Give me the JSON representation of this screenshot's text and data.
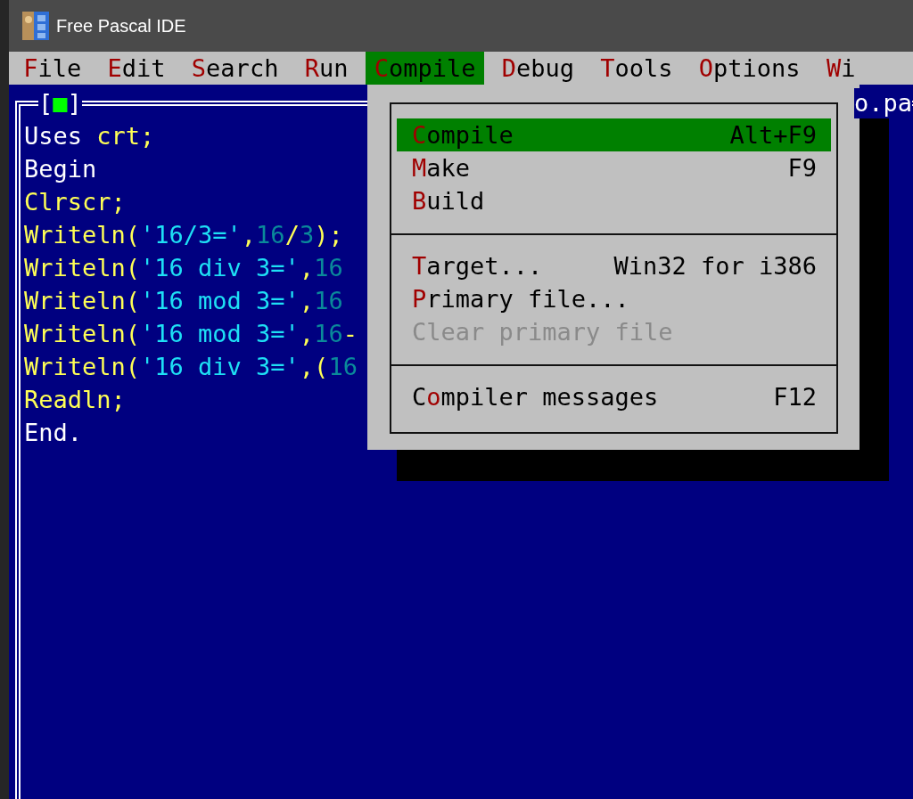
{
  "window": {
    "title": "Free Pascal IDE"
  },
  "menu_bar": [
    {
      "label": {
        "key": "F",
        "post": "ile"
      },
      "selected": false
    },
    {
      "label": {
        "key": "E",
        "post": "dit"
      },
      "selected": false
    },
    {
      "label": {
        "key": "S",
        "post": "earch"
      },
      "selected": false
    },
    {
      "label": {
        "key": "R",
        "post": "un"
      },
      "selected": false
    },
    {
      "label": {
        "key": "C",
        "post": "ompile"
      },
      "selected": true
    },
    {
      "label": {
        "key": "D",
        "post": "ebug"
      },
      "selected": false
    },
    {
      "label": {
        "key": "T",
        "post": "ools"
      },
      "selected": false
    },
    {
      "label": {
        "key": "O",
        "post": "ptions"
      },
      "selected": false
    },
    {
      "label": {
        "key": "W",
        "post": "i"
      },
      "selected": false
    }
  ],
  "editor": {
    "close_button": {
      "open": "[",
      "mark": "■",
      "close": "]"
    },
    "title": "o.pa",
    "lines": [
      [
        {
          "kind": "keyword",
          "text": "Uses"
        },
        {
          "kind": "ident",
          "text": " crt;"
        }
      ],
      [
        {
          "kind": "keyword",
          "text": "Begin"
        }
      ],
      [
        {
          "kind": "ident",
          "text": "Clrscr;"
        }
      ],
      [
        {
          "kind": "ident",
          "text": "Writeln("
        },
        {
          "kind": "string",
          "text": "'16/3='"
        },
        {
          "kind": "ident",
          "text": ","
        },
        {
          "kind": "number",
          "text": "16"
        },
        {
          "kind": "ident",
          "text": "/"
        },
        {
          "kind": "number",
          "text": "3"
        },
        {
          "kind": "ident",
          "text": ");"
        }
      ],
      [
        {
          "kind": "ident",
          "text": "Writeln("
        },
        {
          "kind": "string",
          "text": "'16 div 3='"
        },
        {
          "kind": "ident",
          "text": ","
        },
        {
          "kind": "number",
          "text": "16"
        }
      ],
      [
        {
          "kind": "ident",
          "text": "Writeln("
        },
        {
          "kind": "string",
          "text": "'16 mod 3='"
        },
        {
          "kind": "ident",
          "text": ","
        },
        {
          "kind": "number",
          "text": "16"
        }
      ],
      [
        {
          "kind": "ident",
          "text": "Writeln("
        },
        {
          "kind": "string",
          "text": "'16 mod 3='"
        },
        {
          "kind": "ident",
          "text": ","
        },
        {
          "kind": "number",
          "text": "16"
        },
        {
          "kind": "ident",
          "text": "-"
        }
      ],
      [
        {
          "kind": "ident",
          "text": "Writeln("
        },
        {
          "kind": "string",
          "text": "'16 div 3='"
        },
        {
          "kind": "ident",
          "text": ",("
        },
        {
          "kind": "number",
          "text": "16"
        }
      ],
      [
        {
          "kind": "ident",
          "text": "Readln;"
        }
      ],
      [
        {
          "kind": "keyword",
          "text": "End."
        }
      ]
    ]
  },
  "compile_menu": {
    "sections": [
      [
        {
          "label": {
            "key": "C",
            "post": "ompile"
          },
          "shortcut": "Alt+F9",
          "selected": true,
          "disabled": false
        },
        {
          "label": {
            "key": "M",
            "post": "ake"
          },
          "shortcut": "F9",
          "selected": false,
          "disabled": false
        },
        {
          "label": {
            "key": "B",
            "post": "uild"
          },
          "selected": false,
          "disabled": false
        }
      ],
      [
        {
          "label": {
            "key": "T",
            "post": "arget..."
          },
          "shortcut": "Win32 for i386",
          "selected": false,
          "disabled": false
        },
        {
          "label": {
            "key": "P",
            "post": "rimary file..."
          },
          "selected": false,
          "disabled": false
        },
        {
          "label": {
            "post": "Clear primary file"
          },
          "selected": false,
          "disabled": true
        }
      ],
      [
        {
          "label": {
            "pre": "C",
            "key": "o",
            "post": "mpiler messages"
          },
          "shortcut": "F12",
          "selected": false,
          "disabled": false
        }
      ]
    ]
  }
}
